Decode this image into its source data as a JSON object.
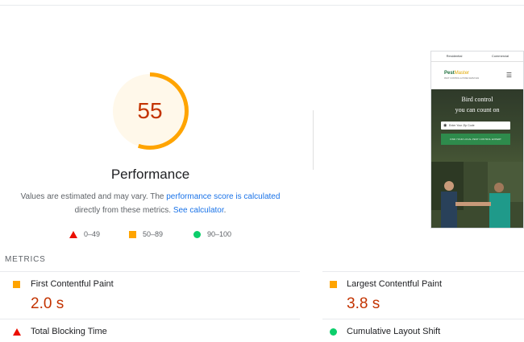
{
  "score": {
    "value": "55",
    "fraction": 0.55,
    "title": "Performance",
    "color": "#ffa400"
  },
  "note": {
    "prefix": "Values are estimated and may vary. The ",
    "link1": "performance score is calculated",
    "middle": "directly from these metrics. ",
    "link2": "See calculator",
    "suffix": "."
  },
  "legend": [
    {
      "shape": "triangle",
      "label": "0–49",
      "color": "#eb0f00"
    },
    {
      "shape": "square",
      "label": "50–89",
      "color": "#ffa400"
    },
    {
      "shape": "circle",
      "label": "90–100",
      "color": "#0cce6b"
    }
  ],
  "preview": {
    "tabs": [
      "Residential",
      "Commercial"
    ],
    "logo_main": "Pest",
    "logo_sub": "Master",
    "tagline": "PEST CONTROL & HOME SERVICES",
    "headline1": "Bird control",
    "headline2": "you can count on",
    "zip_placeholder": "Enter Your Zip Code",
    "cta": "FIND YOUR LOCAL PEST CONTROL EXPERT"
  },
  "metrics": {
    "heading": "METRICS",
    "items": [
      {
        "name": "First Contentful Paint",
        "value": "2.0 s",
        "rating": "average"
      },
      {
        "name": "Largest Contentful Paint",
        "value": "3.8 s",
        "rating": "average"
      },
      {
        "name": "Total Blocking Time",
        "value": "",
        "rating": "fail"
      },
      {
        "name": "Cumulative Layout Shift",
        "value": "",
        "rating": "pass"
      }
    ]
  }
}
